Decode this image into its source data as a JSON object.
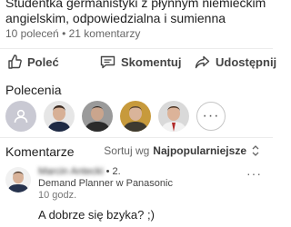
{
  "post": {
    "headline_line1": "Studentka germanistyki z płynnym niemieckim i",
    "headline_line2": "angielskim, odpowiedzialna i sumienna",
    "recommend_count": "10 poleceń",
    "comment_count": "21 komentarzy",
    "separator": "•"
  },
  "actions": {
    "recommend": "Poleć",
    "comment": "Skomentuj",
    "share": "Udostępnij"
  },
  "recommendations": {
    "title": "Polecenia",
    "more": "···"
  },
  "comments": {
    "title": "Komentarze",
    "sort_prefix": "Sortuj wg",
    "sort_value": "Najpopularniejsze",
    "items": [
      {
        "author": "Marcin Antecki",
        "degree": "• 2.",
        "headline": "Demand Planner w Panasonic",
        "time": "10 godz.",
        "text": "A dobrze się bzyka? ;)",
        "more": "···"
      }
    ]
  },
  "colors": {
    "text": "#1f1f1f",
    "muted": "#666666",
    "divider": "#ececec",
    "placeholder_avatar": "#c9c9d3"
  }
}
